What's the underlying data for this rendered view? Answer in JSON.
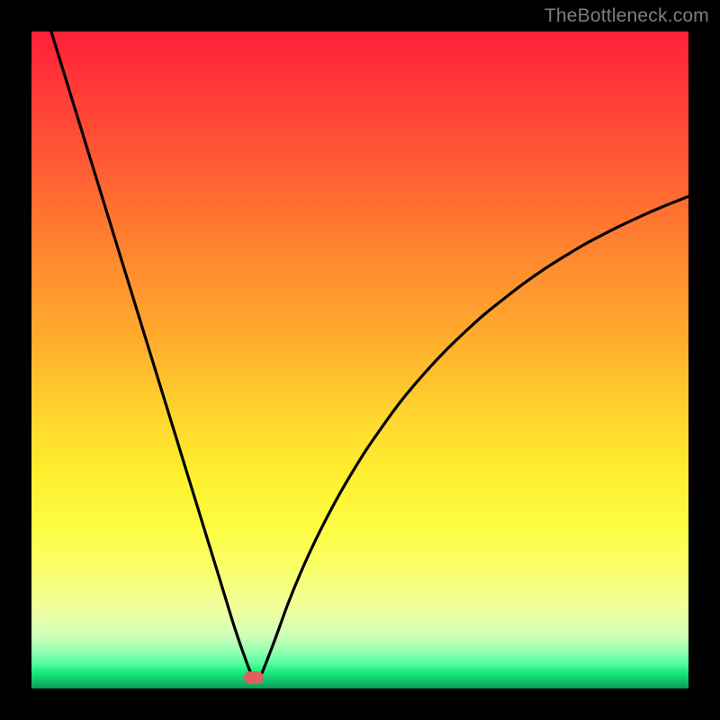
{
  "attribution": "TheBottleneck.com",
  "colors": {
    "page_bg": "#000000",
    "curve": "#000000",
    "marker": "#e06060",
    "attribution_text": "#7d7d7d"
  },
  "chart_data": {
    "type": "line",
    "title": "",
    "xlabel": "",
    "ylabel": "",
    "xlim": [
      0,
      100
    ],
    "ylim": [
      0,
      100
    ],
    "x": [
      3,
      5,
      7,
      9,
      11,
      13,
      15,
      17,
      19,
      21,
      23,
      25,
      27,
      29,
      31,
      33,
      33.6,
      34.2,
      35,
      37,
      39,
      41,
      43,
      45,
      47,
      49,
      51,
      53,
      55,
      57,
      60,
      63,
      66,
      69,
      72,
      75,
      78,
      81,
      84,
      87,
      90,
      93,
      96,
      99,
      100
    ],
    "values": [
      100,
      93.5,
      87,
      80.5,
      74,
      67.5,
      61,
      54.5,
      48,
      41.5,
      35,
      28.5,
      22,
      15.5,
      9,
      3.3,
      2.1,
      1.4,
      2.2,
      7.3,
      12.8,
      17.7,
      22.1,
      26.1,
      29.8,
      33.2,
      36.4,
      39.3,
      42.1,
      44.7,
      48.2,
      51.4,
      54.3,
      57,
      59.4,
      61.7,
      63.8,
      65.7,
      67.5,
      69.1,
      70.6,
      72,
      73.3,
      74.5,
      74.9
    ],
    "marker": {
      "x": 33.8,
      "y": 1.6
    },
    "gradient_stops": [
      {
        "pos": 0.0,
        "color": "#ff1f3a"
      },
      {
        "pos": 0.08,
        "color": "#ff3838"
      },
      {
        "pos": 0.2,
        "color": "#ff5a33"
      },
      {
        "pos": 0.33,
        "color": "#ff842f"
      },
      {
        "pos": 0.46,
        "color": "#ffaa2d"
      },
      {
        "pos": 0.58,
        "color": "#ffd42d"
      },
      {
        "pos": 0.68,
        "color": "#fff02f"
      },
      {
        "pos": 0.76,
        "color": "#fdfd45"
      },
      {
        "pos": 0.82,
        "color": "#f9ff6a"
      },
      {
        "pos": 0.88,
        "color": "#efffa0"
      },
      {
        "pos": 0.92,
        "color": "#cfffb8"
      },
      {
        "pos": 0.945,
        "color": "#8fffb0"
      },
      {
        "pos": 0.963,
        "color": "#4eff9c"
      },
      {
        "pos": 0.976,
        "color": "#18e77e"
      },
      {
        "pos": 0.99,
        "color": "#0fbf66"
      },
      {
        "pos": 1.0,
        "color": "#0c9a53"
      }
    ]
  }
}
